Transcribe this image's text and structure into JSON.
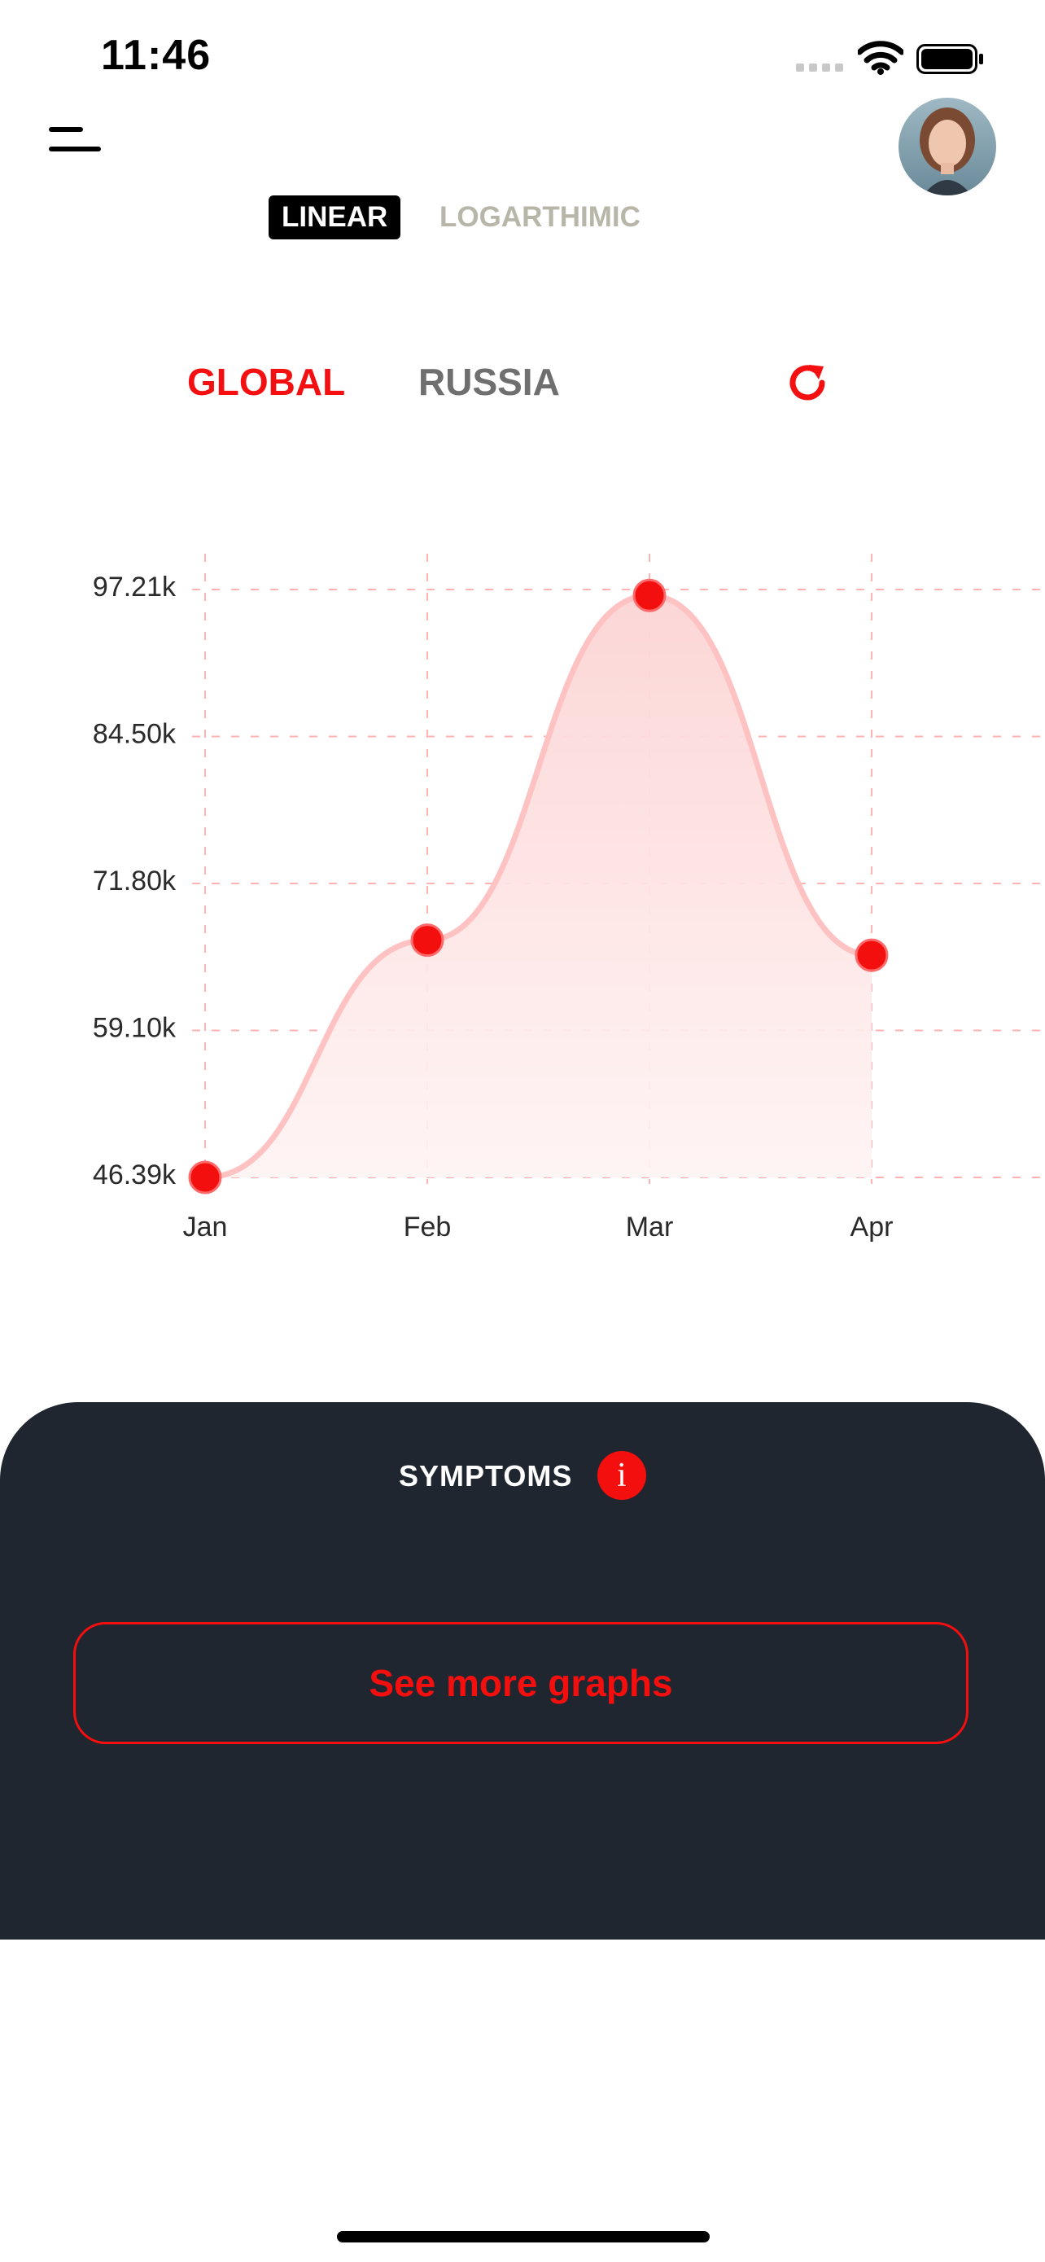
{
  "status_bar": {
    "time": "11:46"
  },
  "header": {
    "menu_icon": "hamburger-menu-icon",
    "avatar_icon": "user-avatar"
  },
  "scale_toggle": {
    "linear": "LINEAR",
    "logarithmic": "LOGARTHIMIC",
    "selected": "LINEAR"
  },
  "region_tabs": {
    "global": "GLOBAL",
    "russia": "RUSSIA",
    "selected": "GLOBAL",
    "refresh_icon": "refresh-icon"
  },
  "colors": {
    "accent": "#f41010",
    "panel": "#1f2630",
    "inactive_tab": "#6f6f6f",
    "inactive_scale": "#b7b6a8"
  },
  "chart_data": {
    "type": "area",
    "categories": [
      "Jan",
      "Feb",
      "Mar",
      "Apr"
    ],
    "values": [
      46390,
      66900,
      96700,
      65600
    ],
    "y_ticks": [
      "46.39k",
      "59.10k",
      "71.80k",
      "84.50k",
      "97.21k"
    ],
    "ylim": [
      46390,
      97210
    ],
    "grid": true,
    "line_color": "#ffc2c2",
    "point_color": "#f40f0f"
  },
  "bottom_panel": {
    "symptoms_label": "SYMPTOMS",
    "info_icon": "i",
    "see_more_button": "See more graphs"
  }
}
